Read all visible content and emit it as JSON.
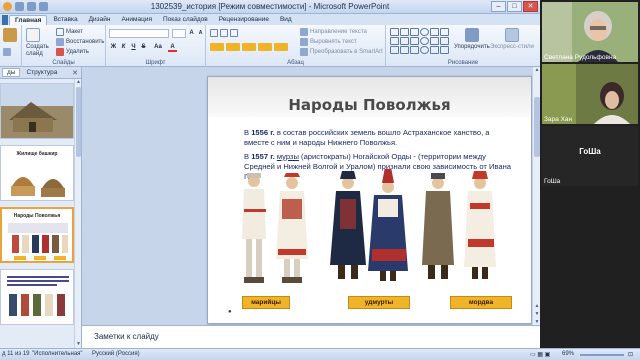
{
  "window": {
    "title": "1302539_история [Режим совместимости] - Microsoft PowerPoint",
    "min": "–",
    "max": "□",
    "close": "✕"
  },
  "tabs": [
    {
      "label": "Главная"
    },
    {
      "label": "Вставка"
    },
    {
      "label": "Дизайн"
    },
    {
      "label": "Анимация"
    },
    {
      "label": "Показ слайдов"
    },
    {
      "label": "Рецензирование"
    },
    {
      "label": "Вид"
    }
  ],
  "ribbon": {
    "clipboard": {
      "label": "",
      "paste": "Вставить"
    },
    "slides": {
      "label": "Слайды",
      "create": "Создать слайд",
      "layout": "Макет",
      "restore": "Восстановить",
      "delete": "Удалить"
    },
    "font": {
      "label": "Шрифт",
      "bold": "Ж",
      "italic": "К",
      "underline": "Ч",
      "strike": "S",
      "clear": "Aa",
      "grow": "A",
      "shrink": "A"
    },
    "paragraph": {
      "label": "Абзац",
      "direction": "Направление текста",
      "align": "Выровнять текст",
      "smartart": "Преобразовать в SmartArt"
    },
    "drawing": {
      "label": "Рисование",
      "arrange": "Упорядочить",
      "quickstyles": "Экспресс-стили"
    }
  },
  "left_pane": {
    "tab_slides": "ды",
    "tab_outline": "Структура",
    "close": "✕",
    "thumbs": [
      {
        "num": "",
        "title": ""
      },
      {
        "num": "",
        "title": "Жилище башкир"
      },
      {
        "num": "",
        "title": "Народы Поволжья"
      },
      {
        "num": "",
        "title": ""
      }
    ]
  },
  "slide": {
    "title": "Народы Поволжья",
    "para1_pre": "В ",
    "para1_year": "1556 г.",
    "para1_post": " в состав российских земель вошло Астраханское ханство, а вместе с ним и народы Нижнего Поволжья.",
    "para2_pre": "В ",
    "para2_year": "1557 г.",
    "para2_mid": " ",
    "para2_link": "мурзы",
    "para2_post": " (аристократы) Ногайской Орды - (территории между Средней и Нижней Волгой и Уралом) признали свою зависимость от Ивана IV.",
    "labels": [
      "марийцы",
      "удмурты",
      "мордва"
    ],
    "bullet": "●"
  },
  "notes": {
    "placeholder": "Заметки к слайду"
  },
  "status": {
    "slide_info": "д 11 из 19",
    "theme": "\"Исполнительная\"",
    "language": "Русский (Россия)",
    "zoom": "69%"
  },
  "video": {
    "participants": [
      {
        "name": "Светлана Рудольфовна"
      },
      {
        "name": "Зара Хан"
      },
      {
        "name": "ГоШа",
        "center_label": "ГоШа"
      }
    ]
  },
  "colors": {
    "ribbon_top": "#f5f8fd",
    "slide_text": "#1c2a6b",
    "label_fill": "#f0b428",
    "title_gray": "#4a4a4a"
  }
}
